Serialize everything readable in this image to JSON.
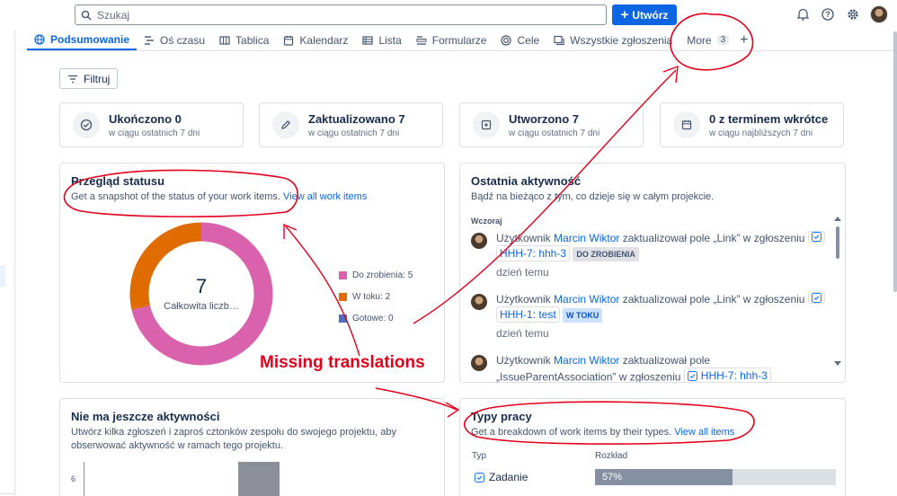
{
  "search": {
    "placeholder": "Szukaj"
  },
  "header": {
    "create_label": "Utwórz"
  },
  "tabs": [
    {
      "label": "Podsumowanie",
      "icon": "globe-icon",
      "active": true
    },
    {
      "label": "Oś czasu",
      "icon": "timeline-icon"
    },
    {
      "label": "Tablica",
      "icon": "board-icon"
    },
    {
      "label": "Kalendarz",
      "icon": "calendar-icon"
    },
    {
      "label": "Lista",
      "icon": "list-icon"
    },
    {
      "label": "Formularze",
      "icon": "forms-icon"
    },
    {
      "label": "Cele",
      "icon": "goals-icon"
    },
    {
      "label": "Wszystkie zgłoszenia",
      "icon": "issues-icon"
    }
  ],
  "more_tab": {
    "label": "More",
    "count": "3"
  },
  "filter": {
    "label": "Filtruj"
  },
  "stats": [
    {
      "title": "Ukończono 0",
      "sub": "w ciągu ostatnich 7 dni",
      "icon": "check-circle-icon"
    },
    {
      "title": "Zaktualizowano 7",
      "sub": "w ciągu ostatnich 7 dni",
      "icon": "edit-icon"
    },
    {
      "title": "Utworzono 7",
      "sub": "w ciągu ostatnich 7 dni",
      "icon": "create-icon"
    },
    {
      "title": "0 z terminem wkrótce",
      "sub": "w ciągu najbliższych 7 dni",
      "icon": "calendar-icon"
    }
  ],
  "status_overview": {
    "title": "Przegląd statusu",
    "sub": "Get a snapshot of the status of your work items.",
    "link": "View all work items",
    "total": "7",
    "total_label": "Całkowita liczb…"
  },
  "chart_data": {
    "type": "pie",
    "categories": [
      "Do zrobienia",
      "W toku",
      "Gotowe"
    ],
    "values": [
      5,
      2,
      0
    ],
    "legend": [
      "Do zrobienia: 5",
      "W toku: 2",
      "Gotowe: 0"
    ],
    "colors": [
      "#da62ac",
      "#e06c00",
      "#4c6fc4"
    ]
  },
  "activity": {
    "title": "Ostatnia aktywność",
    "sub": "Bądź na bieżąco z tym, co dzieje się w całym projekcie.",
    "group": "Wczoraj",
    "items": [
      {
        "prefix": "Użytkownik",
        "user": "Marcin Wiktor",
        "action": "zaktualizował pole „Link” w zgłoszeniu",
        "issue": "HHH-7: hhh-3",
        "status": "DO ZROBIENIA",
        "when": "dzień temu"
      },
      {
        "prefix": "Użytkownik",
        "user": "Marcin Wiktor",
        "action": "zaktualizował pole „Link” w zgłoszeniu",
        "issue": "HHH-1: test",
        "status": "W TOKU",
        "when": "dzień temu"
      },
      {
        "prefix": "Użytkownik",
        "user": "Marcin Wiktor",
        "action": "zaktualizował pole",
        "action2": "„IssueParentAssociation” w zgłoszeniu",
        "issue": "HHH-7: hhh-3"
      }
    ]
  },
  "no_activity": {
    "title": "Nie ma jeszcze aktywności",
    "sub": "Utwórz kilka zgłoszeń i zaproś cztonków zespołu do swojego projektu, aby obserwować aktywność w ramach tego projektu.",
    "axis_tick": "6"
  },
  "work_types": {
    "title": "Typy pracy",
    "sub": "Get a breakdown of work items by their types.",
    "link": "View all items",
    "col_type": "Typ",
    "col_dist": "Rozkład",
    "rows": [
      {
        "label": "Zadanie",
        "percent": 57,
        "percent_label": "57%"
      }
    ]
  },
  "annotation": {
    "text": "Missing translations",
    "color": "#e3001b"
  }
}
